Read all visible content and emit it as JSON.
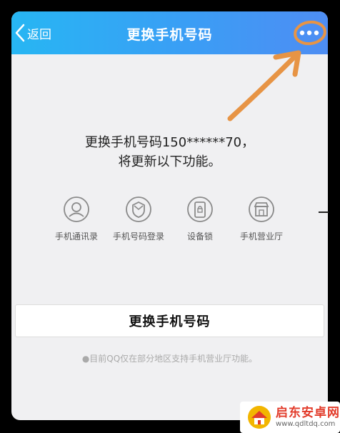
{
  "header": {
    "back_label": "返回",
    "title": "更换手机号码",
    "more_icon": "more-dots-icon"
  },
  "description": {
    "line1": "更换手机号码150******70，",
    "line2": "将更新以下功能。"
  },
  "features": [
    {
      "label": "手机通讯录",
      "icon": "contact-icon"
    },
    {
      "label": "手机号码登录",
      "icon": "login-shield-icon"
    },
    {
      "label": "设备锁",
      "icon": "device-lock-icon"
    },
    {
      "label": "手机营业厅",
      "icon": "store-icon"
    }
  ],
  "action": {
    "change_label": "更换手机号码"
  },
  "note": "●目前QQ仅在部分地区支持手机营业厅功能。",
  "watermark": {
    "name": "启东安卓网",
    "url": "www.qdltdq.com"
  },
  "colors": {
    "header_gradient_start": "#27b6f3",
    "header_gradient_end": "#4e8df3",
    "annotation": "#e79445",
    "background": "#f0f0f2"
  }
}
